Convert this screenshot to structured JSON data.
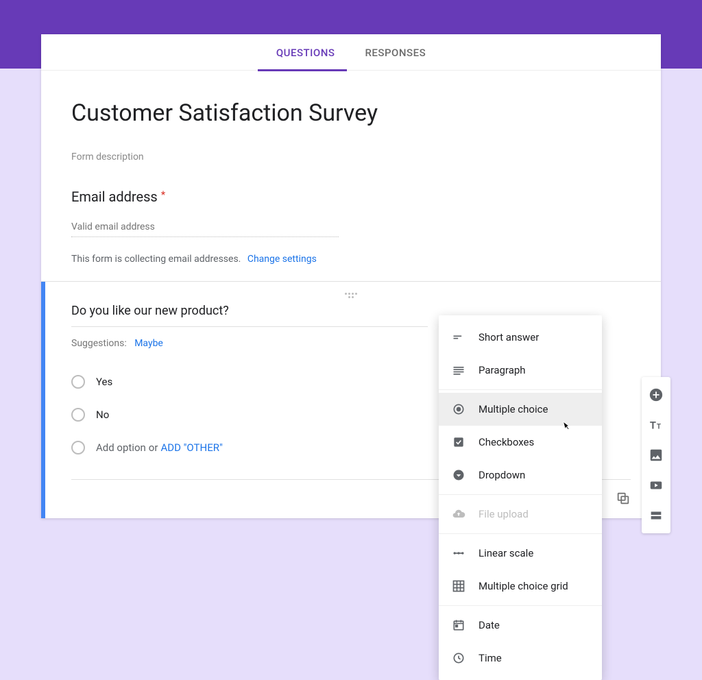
{
  "tabs": {
    "questions": "QUESTIONS",
    "responses": "RESPONSES"
  },
  "form": {
    "title": "Customer Satisfaction Survey",
    "description_placeholder": "Form description",
    "email": {
      "label": "Email address",
      "required_mark": "*",
      "placeholder": "Valid email address",
      "collecting_note": "This form is collecting email addresses.",
      "change_settings": "Change settings"
    }
  },
  "question": {
    "text": "Do you like our new product?",
    "suggestions_label": "Suggestions:",
    "suggestion": "Maybe",
    "options": [
      "Yes",
      "No"
    ],
    "add_option": "Add option",
    "or_label": "or",
    "add_other": "ADD \"OTHER\""
  },
  "type_menu": {
    "short_answer": "Short answer",
    "paragraph": "Paragraph",
    "multiple_choice": "Multiple choice",
    "checkboxes": "Checkboxes",
    "dropdown": "Dropdown",
    "file_upload": "File upload",
    "linear_scale": "Linear scale",
    "multiple_choice_grid": "Multiple choice grid",
    "date": "Date",
    "time": "Time"
  },
  "side_toolbar": {
    "add_question": "Add question",
    "add_title": "Add title and description",
    "add_image": "Add image",
    "add_video": "Add video",
    "add_section": "Add section"
  },
  "colors": {
    "brand": "#673ab7",
    "link": "#1a73e8",
    "accent_blue": "#4285f4"
  }
}
